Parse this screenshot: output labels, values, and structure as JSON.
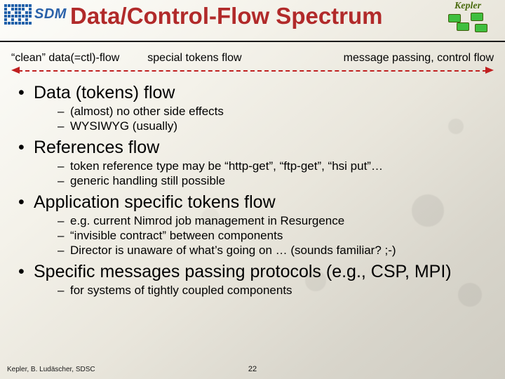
{
  "header": {
    "sdm_text": "SDM",
    "title": "Data/Control-Flow Spectrum",
    "kepler_text": "Kepler"
  },
  "spectrum": {
    "left": "“clean” data(=ctl)-flow",
    "mid": "special tokens flow",
    "right": "message passing, control flow"
  },
  "bullets": [
    {
      "text": "Data (tokens) flow",
      "sub": [
        "(almost) no other side effects",
        "WYSIWYG (usually)"
      ]
    },
    {
      "text": "References flow",
      "sub": [
        "token reference type may be “http-get”, “ftp-get”, “hsi put”…",
        "generic handling still possible"
      ]
    },
    {
      "text": "Application specific tokens flow",
      "sub": [
        "e.g. current Nimrod job management in Resurgence",
        "“invisible contract” between components",
        "Director is unaware of what’s going on … (sounds familiar? ;-)"
      ]
    },
    {
      "text": "Specific messages passing protocols (e.g., CSP, MPI)",
      "sub": [
        "for systems of tightly coupled components"
      ]
    }
  ],
  "footer": {
    "credit": "Kepler, B. Ludäscher, SDSC",
    "page": "22"
  }
}
